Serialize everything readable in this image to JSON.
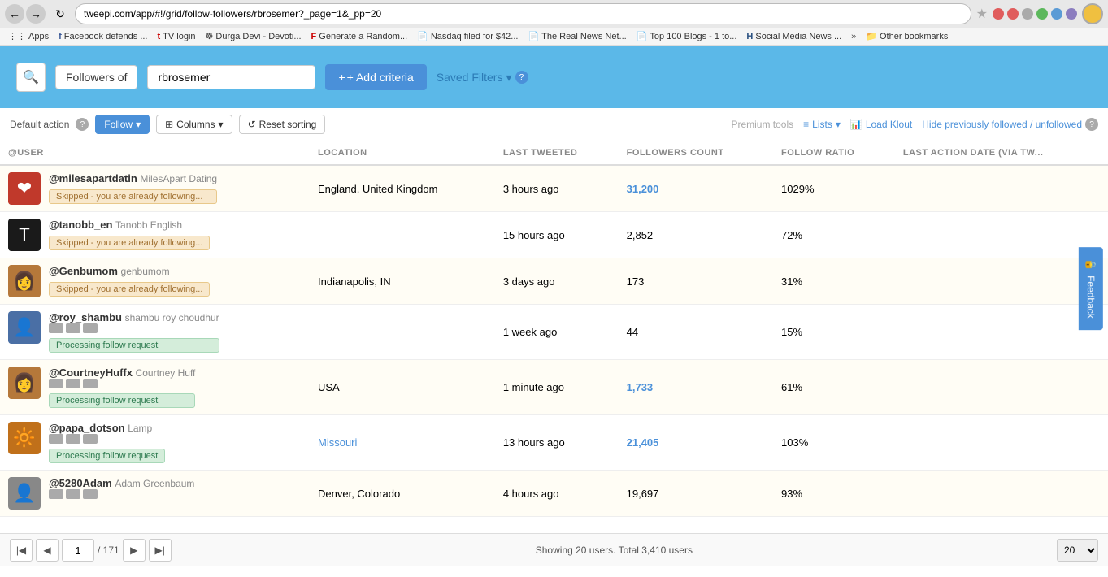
{
  "browser": {
    "url": "tweepi.com/app/#!/grid/follow-followers/rbrosemer?_page=1&_pp=20",
    "bookmarks": [
      {
        "label": "Apps",
        "icon": "⋮⋮"
      },
      {
        "label": "Facebook defends ...",
        "icon": "f",
        "iconColor": "#3b5998"
      },
      {
        "label": "TV login",
        "icon": "t",
        "iconColor": "#cc0000"
      },
      {
        "label": "Durga Devi - Devoti...",
        "icon": "☸"
      },
      {
        "label": "Generate a Random...",
        "icon": "F",
        "iconColor": "#cc0000"
      },
      {
        "label": "Nasdaq filed for $42...",
        "icon": "📄"
      },
      {
        "label": "The Real News Net...",
        "icon": "📄"
      },
      {
        "label": "Top 100 Blogs - 1 to...",
        "icon": "📄"
      },
      {
        "label": "Social Media News ...",
        "icon": "H",
        "iconColor": "#2c5282"
      },
      {
        "label": "»"
      },
      {
        "label": "Other bookmarks",
        "icon": "📁"
      }
    ]
  },
  "filter": {
    "search_icon": "🔍",
    "criteria_label": "Followers of",
    "criteria_value": "rbrosemer",
    "add_criteria_label": "+ Add criteria",
    "saved_filters_label": "Saved Filters"
  },
  "toolbar": {
    "default_action_label": "Default action",
    "follow_label": "Follow",
    "columns_label": "Columns",
    "reset_sorting_label": "Reset sorting",
    "premium_tools_label": "Premium tools",
    "lists_label": "Lists",
    "load_klout_label": "Load Klout",
    "hide_followed_label": "Hide previously followed / unfollowed"
  },
  "table": {
    "columns": [
      {
        "key": "user",
        "label": "@USER"
      },
      {
        "key": "location",
        "label": "LOCATION"
      },
      {
        "key": "last_tweeted",
        "label": "LAST TWEETED"
      },
      {
        "key": "followers_count",
        "label": "FOLLOWERS COUNT"
      },
      {
        "key": "follow_ratio",
        "label": "FOLLOW RATIO"
      },
      {
        "key": "last_action",
        "label": "LAST ACTION DATE (VIA TW..."
      }
    ],
    "rows": [
      {
        "handle": "@milesapartdatin",
        "display_name": "MilesApart Dating",
        "avatar_color": "#c0392b",
        "avatar_emoji": "❤",
        "avatar_bg": "#c0392b",
        "location": "England, United Kingdom",
        "location_linked": false,
        "last_tweeted": "3 hours ago",
        "followers_count": "31,200",
        "followers_linked": true,
        "follow_ratio": "1029%",
        "status": "skipped",
        "status_label": "Skipped - you are already following...",
        "has_icons": false
      },
      {
        "handle": "@tanobb_en",
        "display_name": "Tanobb English",
        "avatar_color": "#1a1a1a",
        "avatar_emoji": "T",
        "avatar_bg": "#2c2c2c",
        "location": "",
        "location_linked": false,
        "last_tweeted": "15 hours ago",
        "followers_count": "2,852",
        "followers_linked": false,
        "follow_ratio": "72%",
        "status": "skipped",
        "status_label": "Skipped - you are already following...",
        "has_icons": false
      },
      {
        "handle": "@Genbumom",
        "display_name": "genbumom",
        "avatar_color": "#888",
        "avatar_emoji": "👩",
        "avatar_bg": "#888",
        "location": "Indianapolis, IN",
        "location_linked": false,
        "last_tweeted": "3 days ago",
        "followers_count": "173",
        "followers_linked": false,
        "follow_ratio": "31%",
        "status": "skipped",
        "status_label": "Skipped - you are already following...",
        "has_icons": false
      },
      {
        "handle": "@roy_shambu",
        "display_name": "shambu roy choudhur",
        "avatar_color": "#555",
        "avatar_emoji": "👤",
        "avatar_bg": "#555",
        "location": "",
        "location_linked": false,
        "last_tweeted": "1 week ago",
        "followers_count": "44",
        "followers_linked": false,
        "follow_ratio": "15%",
        "status": "processing",
        "status_label": "Processing follow request",
        "has_icons": true
      },
      {
        "handle": "@CourtneyHuffx",
        "display_name": "Courtney Huff",
        "avatar_color": "#888",
        "avatar_emoji": "👩",
        "avatar_bg": "#888",
        "location": "USA",
        "location_linked": false,
        "last_tweeted": "1 minute ago",
        "followers_count": "1,733",
        "followers_linked": true,
        "follow_ratio": "61%",
        "status": "processing",
        "status_label": "Processing follow request",
        "has_icons": true
      },
      {
        "handle": "@papa_dotson",
        "display_name": "Lamp",
        "avatar_color": "#c0701a",
        "avatar_emoji": "🔆",
        "avatar_bg": "#c0701a",
        "location": "Missouri",
        "location_linked": true,
        "last_tweeted": "13 hours ago",
        "followers_count": "21,405",
        "followers_linked": true,
        "follow_ratio": "103%",
        "status": "processing",
        "status_label": "Processing follow request",
        "has_icons": true
      },
      {
        "handle": "@5280Adam",
        "display_name": "Adam Greenbaum",
        "avatar_color": "#888",
        "avatar_emoji": "👤",
        "avatar_bg": "#888",
        "location": "Denver, Colorado",
        "location_linked": false,
        "last_tweeted": "4 hours ago",
        "followers_count": "19,697",
        "followers_linked": false,
        "follow_ratio": "93%",
        "status": null,
        "status_label": "",
        "has_icons": true,
        "partial": true
      }
    ]
  },
  "footer": {
    "page_current": "1",
    "page_total": "/ 171",
    "showing_text": "Showing 20 users. Total 3,410 users",
    "per_page_value": "20"
  },
  "feedback": {
    "label": "Feedback"
  }
}
